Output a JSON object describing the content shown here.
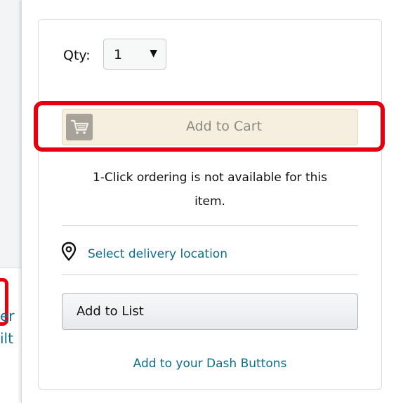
{
  "background": {
    "partial_text_line1": "er",
    "partial_text_line2": "ilt"
  },
  "quantity": {
    "label": "Qty:",
    "value": "1",
    "caret": "▼"
  },
  "add_to_cart": {
    "label": "Add to Cart",
    "icon": "cart-icon"
  },
  "one_click": {
    "line1": "1-Click ordering is not available for this",
    "line2": "item."
  },
  "delivery": {
    "icon": "location-pin-icon",
    "label": "Select delivery location"
  },
  "add_to_list": {
    "label": "Add to List"
  },
  "dash_buttons": {
    "label": "Add to your Dash Buttons"
  },
  "colors": {
    "highlight": "#e3000f",
    "link": "#0f6d86",
    "cart_bg": "#f6efdf"
  }
}
